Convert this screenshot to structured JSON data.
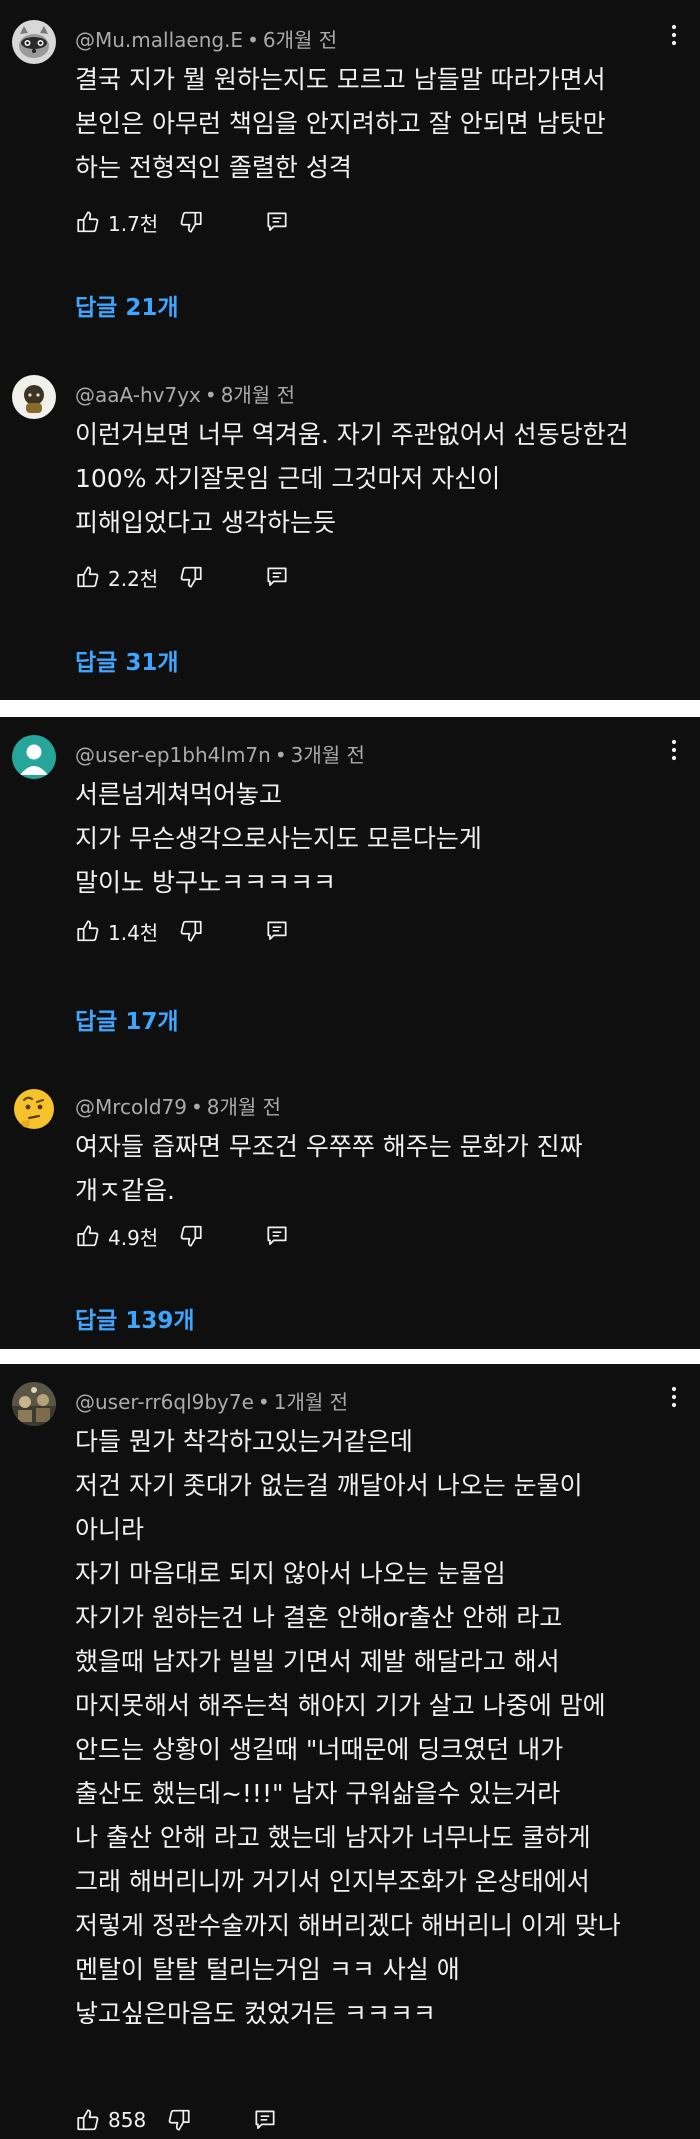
{
  "comments": [
    {
      "author": "@Mu.mallaeng.E",
      "time": "6개월 전",
      "lines": [
        "결국 지가 뭘 원하는지도 모르고 남들말 따라가면서",
        "본인은 아무런 책임을 안지려하고 잘 안되면 남탓만",
        "하는 전형적인 졸렬한 성격"
      ],
      "likes": "1.7천",
      "replies": "답글 21개"
    },
    {
      "author": "@aaA-hv7yx",
      "time": "8개월 전",
      "lines": [
        "이런거보면 너무 역겨움. 자기 주관없어서 선동당한건",
        "100% 자기잘못임 근데 그것마저 자신이",
        "피해입었다고 생각하는듯"
      ],
      "likes": "2.2천",
      "replies": "답글 31개"
    },
    {
      "author": "@user-ep1bh4lm7n",
      "time": "3개월 전",
      "lines": [
        "서른넘게쳐먹어놓고",
        "지가 무슨생각으로사는지도 모른다는게",
        "말이노 방구노ㅋㅋㅋㅋㅋ"
      ],
      "likes": "1.4천",
      "replies": "답글 17개"
    },
    {
      "author": "@Mrcold79",
      "time": "8개월 전",
      "lines": [
        "여자들 즙짜면 무조건 우쭈쭈 해주는 문화가 진짜",
        "개ㅈ같음."
      ],
      "likes": "4.9천",
      "replies": "답글 139개"
    },
    {
      "author": "@user-rr6ql9by7e",
      "time": "1개월 전",
      "lines": [
        "다들 뭔가 착각하고있는거같은데",
        "저건 자기 좃대가 없는걸 깨달아서 나오는 눈물이",
        "아니라",
        "자기 마음대로 되지 않아서 나오는 눈물임",
        "자기가 원하는건 나 결혼 안해or출산 안해 라고",
        "했을때 남자가 빌빌 기면서 제발 해달라고 해서",
        "마지못해서 해주는척 해야지 기가 살고 나중에 맘에",
        "안드는 상황이 생길때 \"너때문에 딩크였던 내가",
        "출산도 했는데~!!!\" 남자 구워삶을수 있는거라",
        "나 출산 안해 라고 했는데 남자가 너무나도 쿨하게",
        "그래 해버리니까 거기서 인지부조화가 온상태에서",
        "저렇게 정관수술까지 해버리겠다 해버리니 이게 맞나",
        "멘탈이 탈탈 털리는거임 ㅋㅋ 사실 애",
        "낳고싶은마음도 컸었거든 ㅋㅋㅋㅋ"
      ],
      "likes": "858",
      "replies": ""
    }
  ],
  "icons": {
    "like": "thumbs-up-icon",
    "dislike": "thumbs-down-icon",
    "reply": "reply-icon",
    "more": "more-vert-icon"
  },
  "colors": {
    "background": "#0f0f0f",
    "text": "#f1f1f1",
    "meta": "#aaaaaa",
    "replies_link": "#3ea6ff",
    "separator": "#ffffff"
  }
}
